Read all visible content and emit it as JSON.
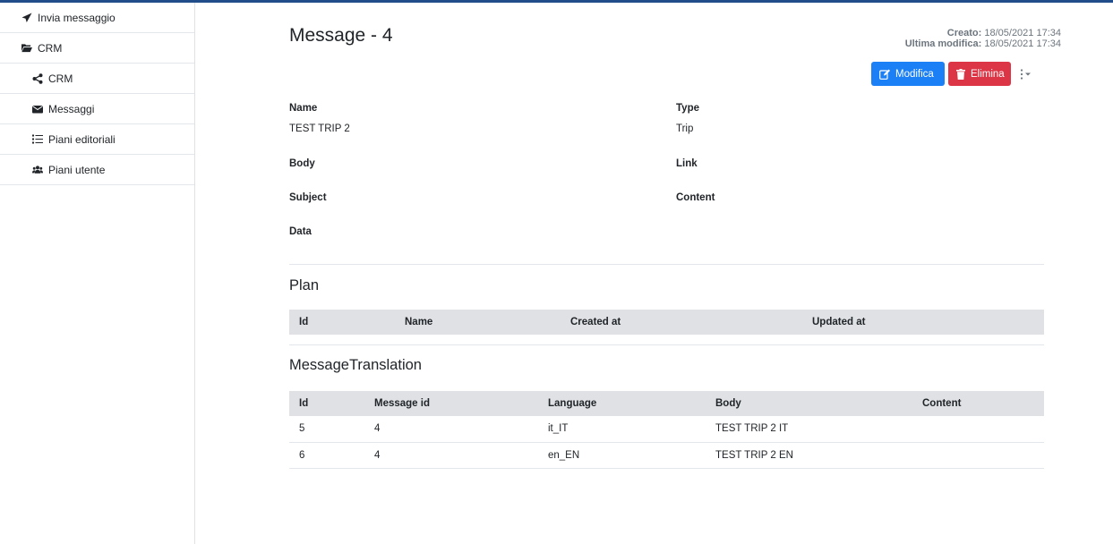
{
  "sidebar": {
    "items": [
      {
        "label": "Invia messaggio",
        "icon": "paper-plane-icon"
      },
      {
        "label": "CRM",
        "icon": "folder-open-icon"
      },
      {
        "label": "CRM",
        "icon": "share-icon"
      },
      {
        "label": "Messaggi",
        "icon": "envelope-icon"
      },
      {
        "label": "Piani editoriali",
        "icon": "list-icon"
      },
      {
        "label": "Piani utente",
        "icon": "users-icon"
      }
    ]
  },
  "header": {
    "title": "Message - 4",
    "created_label": "Creato:",
    "created_value": "18/05/2021 17:34",
    "modified_label": "Ultima modifica:",
    "modified_value": "18/05/2021 17:34"
  },
  "actions": {
    "edit_label": "Modifica",
    "delete_label": "Elimina"
  },
  "fields": {
    "name_label": "Name",
    "name_value": "TEST TRIP 2",
    "type_label": "Type",
    "type_value": "Trip",
    "body_label": "Body",
    "link_label": "Link",
    "subject_label": "Subject",
    "content_label": "Content",
    "data_label": "Data"
  },
  "plan": {
    "title": "Plan",
    "columns": [
      "Id",
      "Name",
      "Created at",
      "Updated at"
    ]
  },
  "translations": {
    "title": "MessageTranslation",
    "columns": [
      "Id",
      "Message id",
      "Language",
      "Body",
      "Content"
    ],
    "rows": [
      [
        "5",
        "4",
        "it_IT",
        "TEST TRIP 2 IT",
        ""
      ],
      [
        "6",
        "4",
        "en_EN",
        "TEST TRIP 2 EN",
        ""
      ]
    ]
  },
  "colors": {
    "primary": "#1b7ff5",
    "danger": "#dc3545",
    "topbar": "#214e8a",
    "table_header": "#dfe1e4"
  }
}
